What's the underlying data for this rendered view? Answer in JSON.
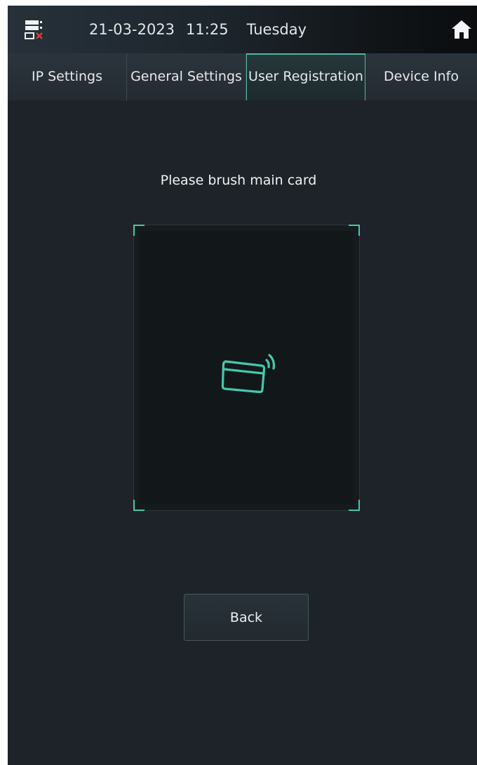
{
  "status_bar": {
    "date": "21-03-2023",
    "time": "11:25",
    "day": "Tuesday",
    "network_icon": "network-disconnected-icon",
    "home_icon": "home-icon"
  },
  "tabs": [
    {
      "label": "IP Settings",
      "active": false
    },
    {
      "label": "General Settings",
      "active": false
    },
    {
      "label": "User Registration",
      "active": true
    },
    {
      "label": "Device Info",
      "active": false
    }
  ],
  "main": {
    "prompt": "Please brush main card",
    "card_icon": "card-swipe-icon",
    "back_label": "Back"
  },
  "colors": {
    "accent": "#45c8ac",
    "background": "#1e2329",
    "error": "#e23b3b"
  }
}
